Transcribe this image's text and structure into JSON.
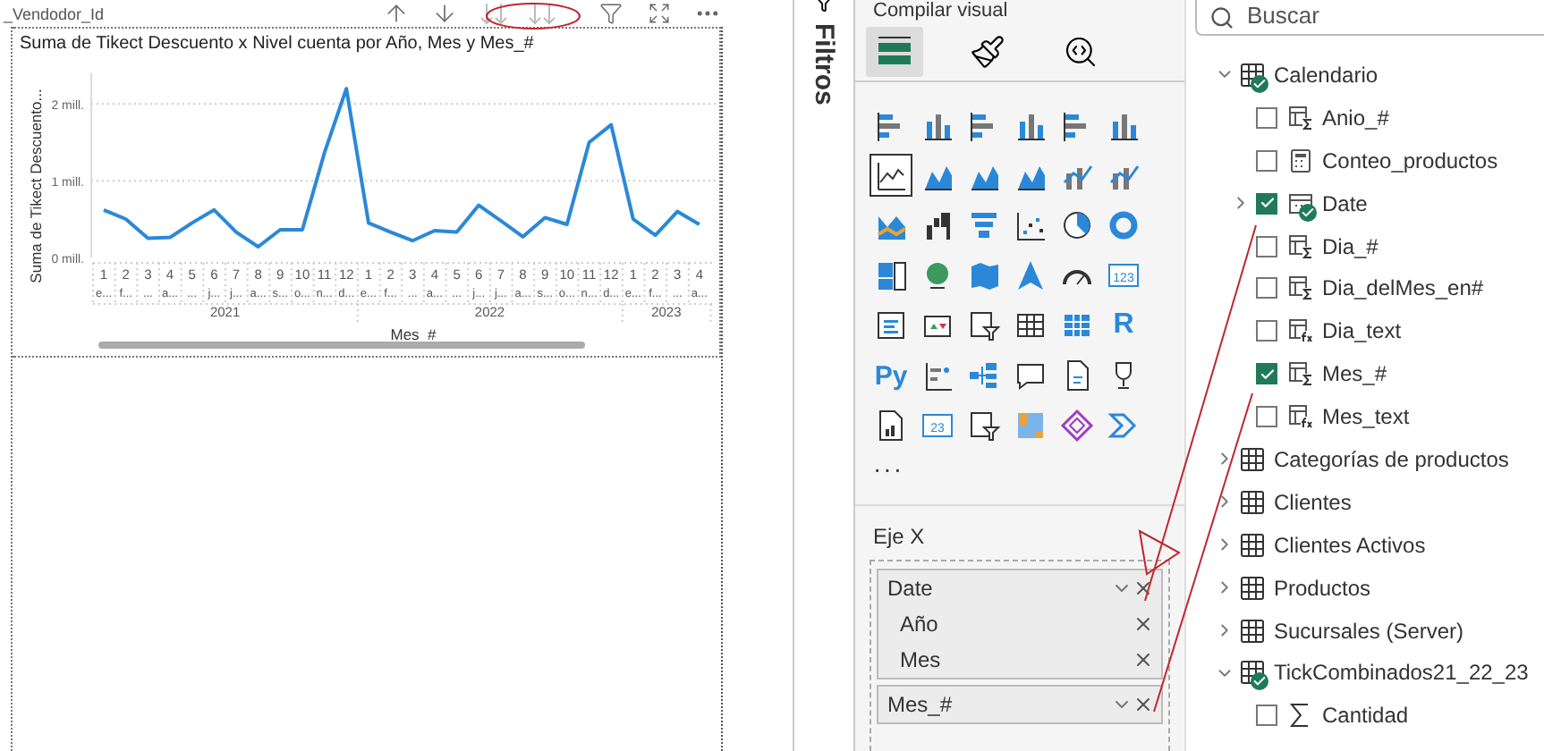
{
  "report": {
    "filter_chip": "_Vendodor_Id",
    "visual": {
      "chart_data": {
        "type": "line",
        "title": "Suma de Tikect Descuento x Nivel cuenta por Año, Mes y Mes_#",
        "xlabel": "Mes_#",
        "ylabel": "Suma de Tikect Descuento...",
        "categories": [
          "1",
          "2",
          "3",
          "4",
          "5",
          "6",
          "7",
          "8",
          "9",
          "10",
          "11",
          "12",
          "1",
          "2",
          "3",
          "4",
          "5",
          "6",
          "7",
          "8",
          "9",
          "10",
          "11",
          "12",
          "1",
          "2",
          "3",
          "4"
        ],
        "series": [
          {
            "color": "#2b88d8",
            "values": [
              0.62,
              0.5,
              0.25,
              0.26,
              0.45,
              0.62,
              0.33,
              0.14,
              0.36,
              0.36,
              1.36,
              2.2,
              0.45,
              0.33,
              0.22,
              0.35,
              0.33,
              0.68,
              0.48,
              0.27,
              0.52,
              0.43,
              1.5,
              1.73,
              0.5,
              0.29,
              0.6,
              0.43
            ]
          }
        ],
        "ylim": [
          0,
          2.4
        ],
        "yticks": [
          {
            "value": 0,
            "label": "0 mill."
          },
          {
            "value": 1,
            "label": "1 mill."
          },
          {
            "value": 2,
            "label": "2 mill."
          }
        ]
      },
      "x_axis": {
        "ticks": [
          {
            "sublabel": "e...",
            "group_start": "2021"
          },
          {
            "sublabel": "f..."
          },
          {
            "sublabel": "..."
          },
          {
            "sublabel": "a..."
          },
          {
            "sublabel": "..."
          },
          {
            "sublabel": "j..."
          },
          {
            "sublabel": "j..."
          },
          {
            "sublabel": "a..."
          },
          {
            "sublabel": "s..."
          },
          {
            "sublabel": "o..."
          },
          {
            "sublabel": "n..."
          },
          {
            "sublabel": "d..."
          },
          {
            "sublabel": "e...",
            "group_start": "2022"
          },
          {
            "sublabel": "f..."
          },
          {
            "sublabel": "..."
          },
          {
            "sublabel": "a..."
          },
          {
            "sublabel": "..."
          },
          {
            "sublabel": "j..."
          },
          {
            "sublabel": "j..."
          },
          {
            "sublabel": "a..."
          },
          {
            "sublabel": "s..."
          },
          {
            "sublabel": "o..."
          },
          {
            "sublabel": "n..."
          },
          {
            "sublabel": "d..."
          },
          {
            "sublabel": "e...",
            "group_start": "2023"
          },
          {
            "sublabel": "f..."
          },
          {
            "sublabel": "..."
          },
          {
            "sublabel": "a..."
          }
        ]
      }
    }
  },
  "filters_pane": {
    "title": "Filtros"
  },
  "visualizations_pane": {
    "title": "Compilar visual",
    "gallery": [
      {
        "kind": "hbar",
        "selected": false
      },
      {
        "kind": "column",
        "selected": false
      },
      {
        "kind": "hbar",
        "selected": false
      },
      {
        "kind": "column",
        "selected": false
      },
      {
        "kind": "hbar",
        "selected": false
      },
      {
        "kind": "column",
        "selected": false
      },
      {
        "kind": "line",
        "selected": true
      },
      {
        "kind": "area",
        "selected": false
      },
      {
        "kind": "area",
        "selected": false
      },
      {
        "kind": "area",
        "selected": false
      },
      {
        "kind": "combo",
        "selected": false
      },
      {
        "kind": "combo",
        "selected": false
      },
      {
        "kind": "ribbon",
        "selected": false
      },
      {
        "kind": "waterfall",
        "selected": false
      },
      {
        "kind": "funnel",
        "selected": false
      },
      {
        "kind": "scatter",
        "selected": false
      },
      {
        "kind": "pie",
        "selected": false
      },
      {
        "kind": "donut",
        "selected": false
      },
      {
        "kind": "treemap",
        "selected": false
      },
      {
        "kind": "globe",
        "selected": false
      },
      {
        "kind": "map",
        "selected": false
      },
      {
        "kind": "arrow",
        "selected": false
      },
      {
        "kind": "gauge",
        "selected": false
      },
      {
        "kind": "card",
        "label": "123",
        "selected": false
      },
      {
        "kind": "list",
        "selected": false
      },
      {
        "kind": "kpi",
        "selected": false
      },
      {
        "kind": "slicer",
        "selected": false
      },
      {
        "kind": "table",
        "selected": false
      },
      {
        "kind": "matrix",
        "selected": false
      },
      {
        "kind": "letter",
        "label": "R",
        "selected": false
      },
      {
        "kind": "letter",
        "label": "Py",
        "selected": false
      },
      {
        "kind": "influencers",
        "selected": false
      },
      {
        "kind": "tree",
        "selected": false
      },
      {
        "kind": "bubble",
        "selected": false
      },
      {
        "kind": "doc",
        "selected": false
      },
      {
        "kind": "trophy",
        "selected": false
      },
      {
        "kind": "report",
        "selected": false
      },
      {
        "kind": "card",
        "label": "23",
        "selected": false
      },
      {
        "kind": "slicer",
        "selected": false
      },
      {
        "kind": "app",
        "selected": false
      },
      {
        "kind": "diamond",
        "selected": false
      },
      {
        "kind": "chevron",
        "selected": false
      }
    ],
    "more": "···",
    "well": {
      "label": "Eje X",
      "fields": [
        {
          "name": "Date",
          "children": [
            {
              "name": "Año"
            },
            {
              "name": "Mes"
            }
          ]
        },
        {
          "name": "Mes_#"
        }
      ]
    }
  },
  "data_pane": {
    "search": {
      "placeholder": "Buscar"
    },
    "tables": [
      {
        "name": "Calendario",
        "expanded": true,
        "in_use": true,
        "fields": [
          {
            "name": "Anio_#",
            "kind": "numeric",
            "checked": false,
            "in_use": false,
            "expandable": false
          },
          {
            "name": "Conteo_productos",
            "kind": "measure",
            "checked": false,
            "in_use": false,
            "expandable": false
          },
          {
            "name": "Date",
            "kind": "date",
            "checked": true,
            "in_use": true,
            "expandable": true
          },
          {
            "name": "Dia_#",
            "kind": "numeric",
            "checked": false,
            "in_use": false,
            "expandable": false
          },
          {
            "name": "Dia_delMes_en#",
            "kind": "numeric",
            "checked": false,
            "in_use": false,
            "expandable": false
          },
          {
            "name": "Dia_text",
            "kind": "calculated",
            "checked": false,
            "in_use": false,
            "expandable": false
          },
          {
            "name": "Mes_#",
            "kind": "numeric",
            "checked": true,
            "in_use": false,
            "expandable": false
          },
          {
            "name": "Mes_text",
            "kind": "calculated",
            "checked": false,
            "in_use": false,
            "expandable": false
          }
        ]
      },
      {
        "name": "Categorías de productos",
        "expanded": false,
        "in_use": false
      },
      {
        "name": "Clientes",
        "expanded": false,
        "in_use": false
      },
      {
        "name": "Clientes Activos",
        "expanded": false,
        "in_use": false
      },
      {
        "name": "Productos",
        "expanded": false,
        "in_use": false
      },
      {
        "name": "Sucursales (Server)",
        "expanded": false,
        "in_use": false
      },
      {
        "name": "TickCombinados21_22_23",
        "expanded": true,
        "in_use": true,
        "fields": [
          {
            "name": "Cantidad",
            "kind": "sum",
            "checked": false,
            "in_use": false,
            "expandable": false
          }
        ]
      }
    ]
  }
}
